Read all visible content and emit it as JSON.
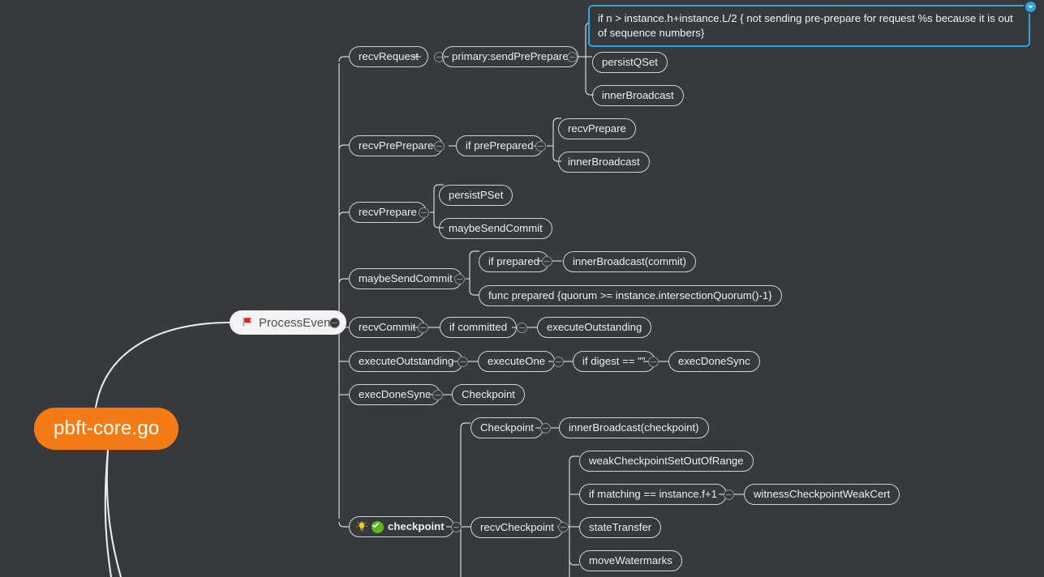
{
  "app": {
    "background_color": "#37393d",
    "root_color": "#f57c14",
    "selection_color": "#2ba6e0",
    "node_border_color": "#cfd2d6",
    "node_text_color": "#eceff1"
  },
  "mindmap": {
    "root": {
      "label": "pbft-core.go"
    },
    "branch": {
      "label": "ProcessEvent",
      "icon": "red-flag-icon"
    },
    "nodes": {
      "recv_request": "recvRequest",
      "primary_send_preprepare": "primary:sendPrePrepare",
      "note_out_of_sequence": "if n > instance.h+instance.L/2 { not sending pre-prepare for request %s because it is out of sequence numbers}",
      "persist_qset": "persistQSet",
      "inner_broadcast_1": "innerBroadcast",
      "recv_preprepare": "recvPrePrepare",
      "if_preprepared": "if prePrepared",
      "recv_prepare_child": "recvPrepare",
      "inner_broadcast_2": "innerBroadcast",
      "recv_prepare": "recvPrepare",
      "persist_pset": "persistPSet",
      "maybe_send_commit_child": "maybeSendCommit",
      "maybe_send_commit": "maybeSendCommit",
      "if_prepared": "if prepared",
      "inner_broadcast_commit": "innerBroadcast(commit)",
      "func_prepared": "func prepared {quorum >= instance.intersectionQuorum()-1}",
      "recv_commit": "recvCommit",
      "if_committed": "if committed",
      "execute_outstanding_child": "executeOutstanding",
      "execute_outstanding": "executeOutstanding",
      "execute_one": "executeOne",
      "if_digest_empty": "if digest == \"\"",
      "exec_done_sync_child": "execDoneSync",
      "exec_done_sync": "execDoneSync",
      "checkpoint_child": "Checkpoint",
      "checkpoint_marked": "checkpoint",
      "checkpoint_sub": "Checkpoint",
      "inner_broadcast_checkpoint": "innerBroadcast(checkpoint)",
      "recv_checkpoint": "recvCheckpoint",
      "weak_checkpoint_out_of_range": "weakCheckpointSetOutOfRange",
      "if_matching": "if matching == instance.f+1",
      "witness_checkpoint_weak_cert": "witnessCheckpointWeakCert",
      "state_transfer": "stateTransfer",
      "move_watermarks": "moveWatermarks"
    }
  }
}
